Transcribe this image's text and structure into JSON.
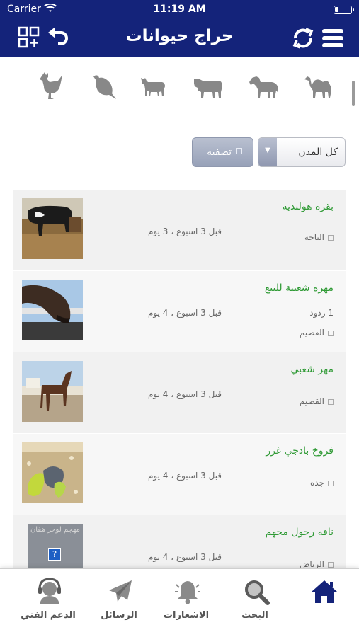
{
  "status": {
    "carrier": "Carrier",
    "time": "11:19 AM"
  },
  "header": {
    "title": "حراج حيوانات",
    "left_icons": [
      "grid-add-icon",
      "back-arrow-icon"
    ],
    "right_icons": [
      "refresh-icon",
      "menu-icon"
    ]
  },
  "categories": [
    "camel-icon",
    "horse-icon",
    "cow-icon",
    "goat-icon",
    "bird-icon",
    "rooster-icon"
  ],
  "filters": {
    "city_select": "كل المدن",
    "filter_button": "تصفيه"
  },
  "listings": [
    {
      "title": "بقرة هولندية",
      "replies": "",
      "city": "الباحة",
      "time_ago": "قبل 3 اسبوع ، 3 يوم"
    },
    {
      "title": "مهره شعبية للبيع",
      "replies": "1 ردود",
      "city": "القصيم",
      "time_ago": "قبل 3 اسبوع ، 4 يوم"
    },
    {
      "title": "مهر شعبي",
      "replies": "",
      "city": "القصيم",
      "time_ago": "قبل 3 اسبوع ، 4 يوم"
    },
    {
      "title": "فروخ بادجي غرر",
      "replies": "",
      "city": "جده",
      "time_ago": "قبل 3 اسبوع ، 4 يوم"
    },
    {
      "title": "ناقه رحول مجهم",
      "replies": "",
      "city": "الرياض",
      "time_ago": "قبل 3 اسبوع ، 4 يوم",
      "image_placeholder": "مهجم لوحر هقان"
    }
  ],
  "tabs": [
    {
      "label": "",
      "icon": "home-icon",
      "active": true
    },
    {
      "label": "البحث",
      "icon": "search-icon"
    },
    {
      "label": "الاشعارات",
      "icon": "bell-icon"
    },
    {
      "label": "الرسائل",
      "icon": "paper-plane-icon"
    },
    {
      "label": "الدعم الفني",
      "icon": "support-icon"
    }
  ],
  "colors": {
    "header_bg": "#14237a",
    "title_green": "#2f9a35",
    "active_tab": "#14237a"
  }
}
